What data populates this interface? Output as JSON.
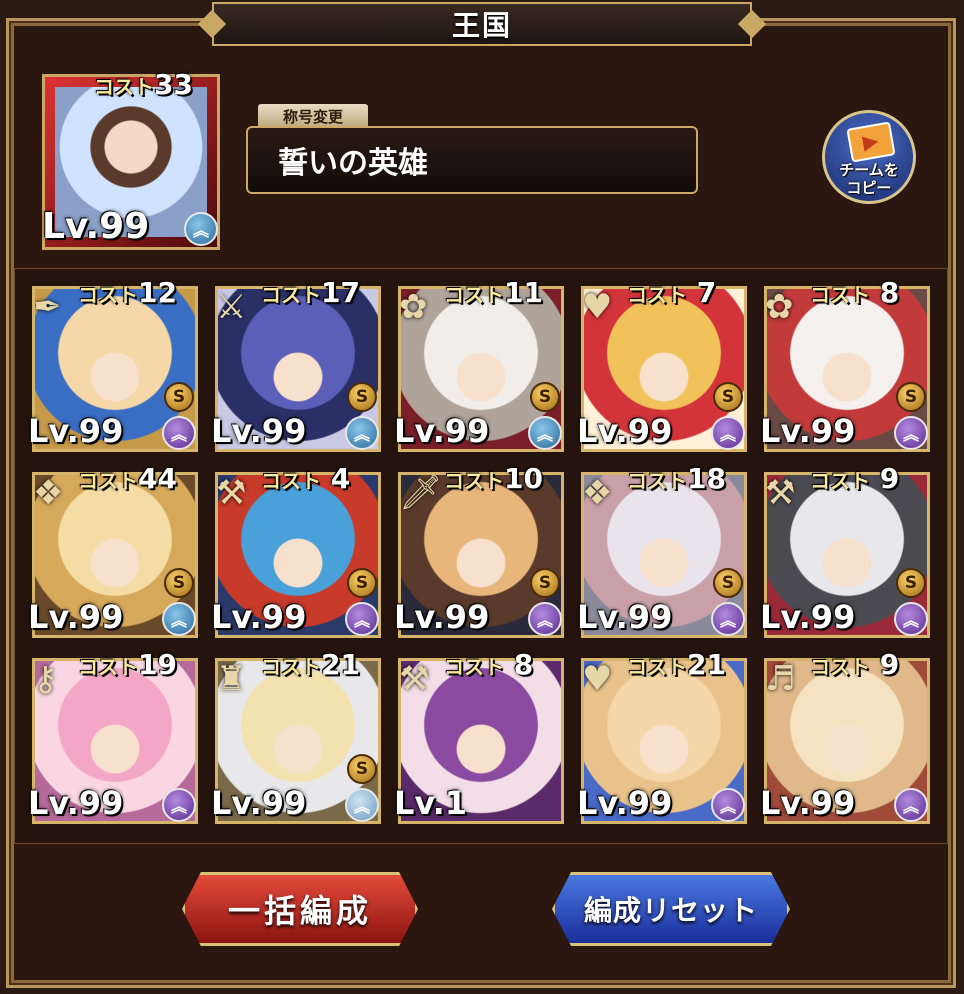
{
  "window": {
    "title": "王国"
  },
  "leader": {
    "cost_label": "コスト",
    "cost": "33",
    "level": "Lv.99",
    "rank": "purple"
  },
  "title_section": {
    "rename_label": "称号変更",
    "current_title": "誓いの英雄"
  },
  "copy_button": {
    "label": "チームを\nコピー"
  },
  "units": [
    {
      "cost": "12",
      "level": "Lv.99",
      "s": true,
      "rank": "purple",
      "icon": "feather-icon",
      "palette": [
        "#f6d7a8",
        "#3a6ec2",
        "#c79a4a"
      ]
    },
    {
      "cost": "17",
      "level": "Lv.99",
      "s": true,
      "rank": "blue",
      "icon": "weapon-icon",
      "palette": [
        "#5b5fb8",
        "#2a2f66",
        "#c9c9e6"
      ]
    },
    {
      "cost": "11",
      "level": "Lv.99",
      "s": true,
      "rank": "blue",
      "icon": "flower-icon",
      "palette": [
        "#f1eee9",
        "#b0a49a",
        "#7a1f2a"
      ]
    },
    {
      "cost": "7",
      "level": "Lv.99",
      "s": true,
      "rank": "purple",
      "icon": "heart-icon",
      "palette": [
        "#f2c25a",
        "#d3343a",
        "#fff0d8"
      ]
    },
    {
      "cost": "8",
      "level": "Lv.99",
      "s": true,
      "rank": "purple",
      "icon": "flower-icon",
      "palette": [
        "#f4f0ee",
        "#c23a3a",
        "#6a4a44"
      ]
    },
    {
      "cost": "44",
      "level": "Lv.99",
      "s": true,
      "rank": "blue",
      "icon": "crest-icon",
      "palette": [
        "#f5dca4",
        "#d6a85a",
        "#6a4a2a"
      ]
    },
    {
      "cost": "4",
      "level": "Lv.99",
      "s": true,
      "rank": "purple",
      "icon": "axe-icon",
      "palette": [
        "#4aa0d8",
        "#c83a2a",
        "#2a3a6a"
      ]
    },
    {
      "cost": "10",
      "level": "Lv.99",
      "s": true,
      "rank": "purple",
      "icon": "sword-icon",
      "palette": [
        "#e8b67a",
        "#5a3a2a",
        "#2a2a3a"
      ]
    },
    {
      "cost": "18",
      "level": "Lv.99",
      "s": true,
      "rank": "purple",
      "icon": "crest-icon",
      "palette": [
        "#e9e4ec",
        "#c9a0a8",
        "#8a8a9a"
      ]
    },
    {
      "cost": "9",
      "level": "Lv.99",
      "s": true,
      "rank": "purple",
      "icon": "axe-icon",
      "palette": [
        "#e8e8ea",
        "#4a4a50",
        "#9a2a3a"
      ]
    },
    {
      "cost": "19",
      "level": "Lv.99",
      "s": false,
      "rank": "purple",
      "icon": "key-icon",
      "palette": [
        "#f4a6c6",
        "#f9d6e2",
        "#b56a9a"
      ]
    },
    {
      "cost": "21",
      "level": "Lv.99",
      "s": true,
      "rank": "pale",
      "icon": "castle-icon",
      "palette": [
        "#f3e2b0",
        "#e8e8ea",
        "#7a6a4a"
      ]
    },
    {
      "cost": "8",
      "level": "Lv.1",
      "s": false,
      "rank": "none",
      "icon": "tool-icon",
      "palette": [
        "#8a4aa0",
        "#f3dde6",
        "#5a2a6a"
      ]
    },
    {
      "cost": "21",
      "level": "Lv.99",
      "s": false,
      "rank": "purple",
      "icon": "heart-icon",
      "palette": [
        "#f4d6a8",
        "#e8c28a",
        "#4a6ac8"
      ]
    },
    {
      "cost": "9",
      "level": "Lv.99",
      "s": false,
      "rank": "purple",
      "icon": "harp-icon",
      "palette": [
        "#f4e2c0",
        "#e0b88a",
        "#a04a3a"
      ]
    }
  ],
  "buttons": {
    "bulk_form": "一括編成",
    "reset_form": "編成リセット"
  },
  "labels": {
    "cost": "コスト",
    "s": "S",
    "rank_symbol": "︽"
  }
}
